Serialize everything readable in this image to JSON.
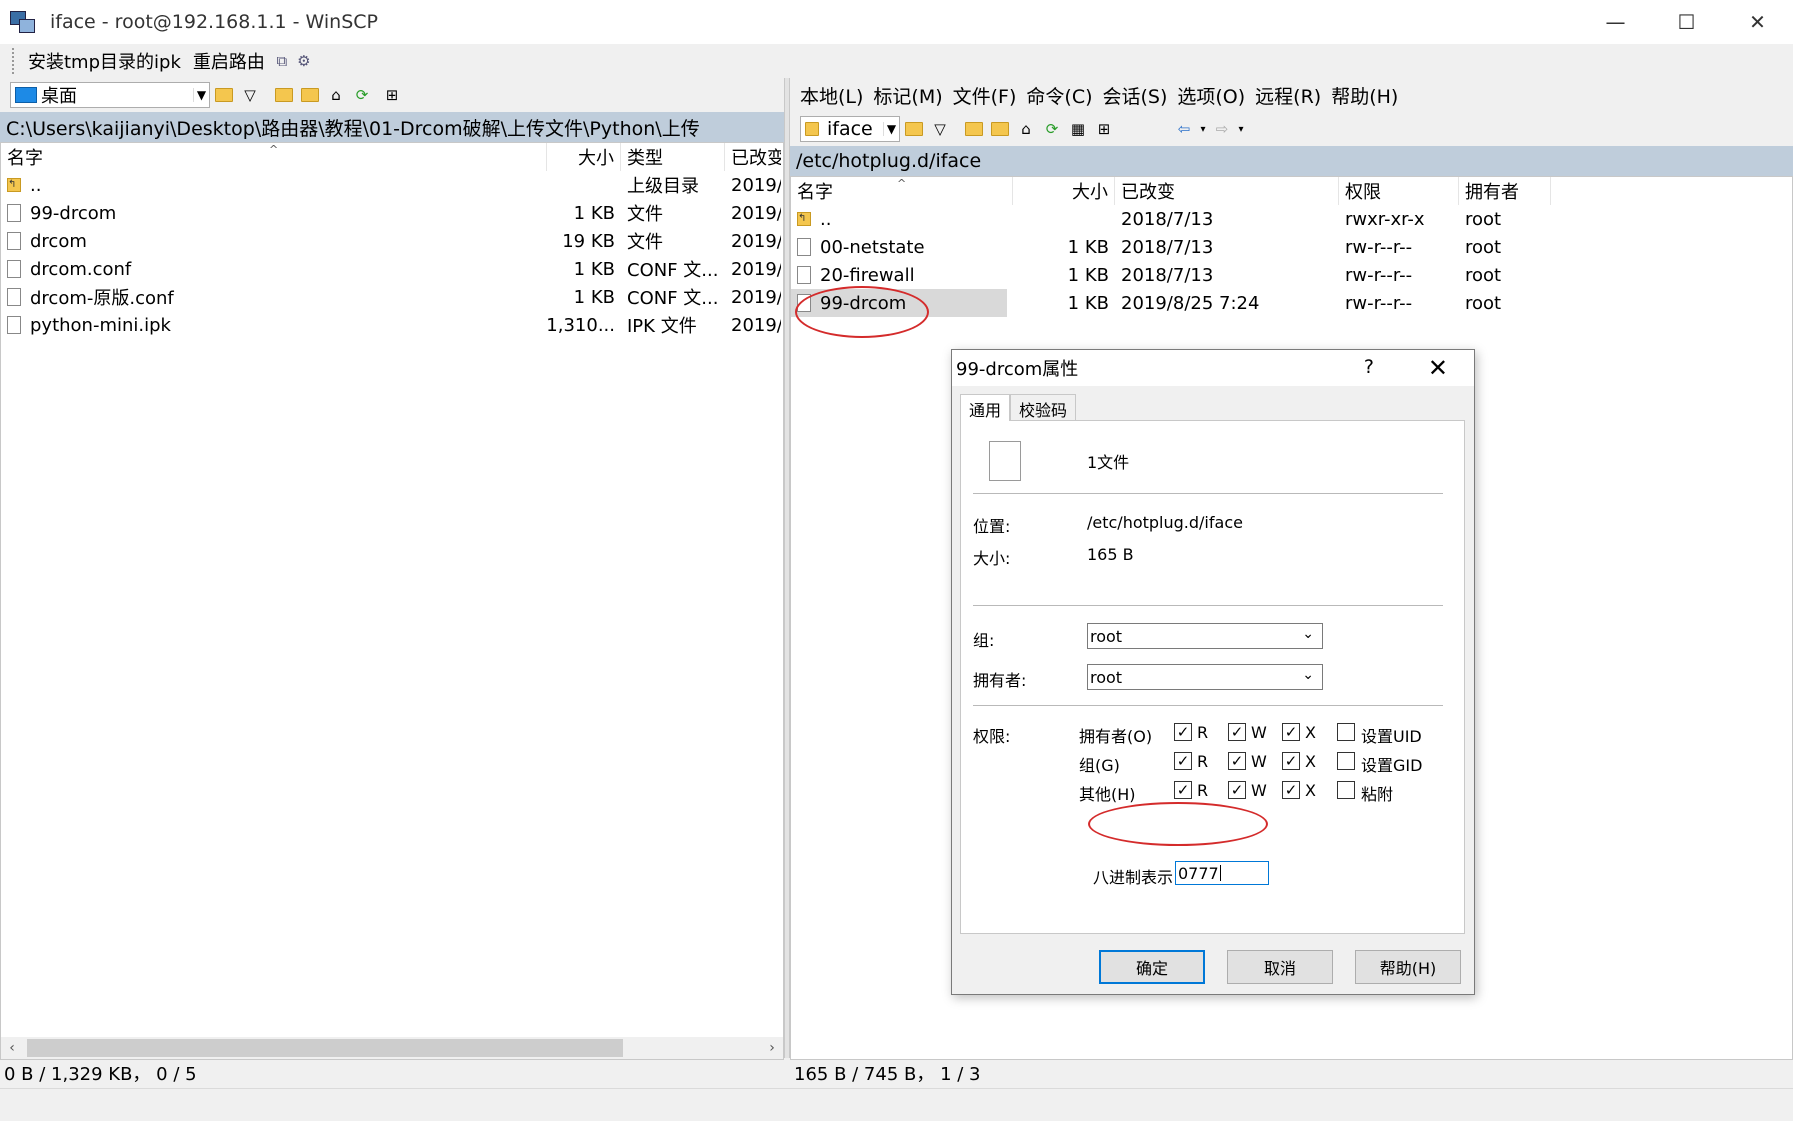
{
  "window": {
    "title": "iface - root@192.168.1.1 - WinSCP",
    "minimize": "—",
    "maximize": "☐",
    "close": "✕"
  },
  "custom_commands": {
    "install": "安装tmp目录的ipk",
    "restart": "重启路由"
  },
  "local": {
    "drive": "桌面",
    "path": "C:\\Users\\kaijianyi\\Desktop\\路由器\\教程\\01-Drcom破解\\上传文件\\Python\\上传",
    "columns": [
      "名字",
      "大小",
      "类型",
      "已改变"
    ],
    "files": [
      {
        "name": "..",
        "size": "",
        "type": "上级目录",
        "changed": "2019/"
      },
      {
        "name": "99-drcom",
        "size": "1 KB",
        "type": "文件",
        "changed": "2019/"
      },
      {
        "name": "drcom",
        "size": "19 KB",
        "type": "文件",
        "changed": "2019/"
      },
      {
        "name": "drcom.conf",
        "size": "1 KB",
        "type": "CONF 文...",
        "changed": "2019/"
      },
      {
        "name": "drcom-原版.conf",
        "size": "1 KB",
        "type": "CONF 文...",
        "changed": "2019/"
      },
      {
        "name": "python-mini.ipk",
        "size": "1,310...",
        "type": "IPK 文件",
        "changed": "2019/"
      }
    ],
    "status": "0 B / 1,329 KB， 0 / 5"
  },
  "remote": {
    "menu": [
      "本地(L)",
      "标记(M)",
      "文件(F)",
      "命令(C)",
      "会话(S)",
      "选项(O)",
      "远程(R)",
      "帮助(H)"
    ],
    "folder": "iface",
    "path": "/etc/hotplug.d/iface",
    "columns": [
      "名字",
      "大小",
      "已改变",
      "权限",
      "拥有者"
    ],
    "files": [
      {
        "name": "..",
        "size": "",
        "changed": "2018/7/13",
        "rights": "rwxr-xr-x",
        "owner": "root"
      },
      {
        "name": "00-netstate",
        "size": "1 KB",
        "changed": "2018/7/13",
        "rights": "rw-r--r--",
        "owner": "root"
      },
      {
        "name": "20-firewall",
        "size": "1 KB",
        "changed": "2018/7/13",
        "rights": "rw-r--r--",
        "owner": "root"
      },
      {
        "name": "99-drcom",
        "size": "1 KB",
        "changed": "2019/8/25 7:24",
        "rights": "rw-r--r--",
        "owner": "root"
      }
    ],
    "status": "165 B / 745 B， 1 / 3"
  },
  "dialog": {
    "title": "99-drcom属性",
    "help": "?",
    "close": "✕",
    "tabs": [
      "通用",
      "校验码"
    ],
    "file_count": "1文件",
    "location_label": "位置:",
    "location": "/etc/hotplug.d/iface",
    "size_label": "大小:",
    "size": "165 B",
    "group_label": "组:",
    "group": "root",
    "owner_label": "拥有者:",
    "owner": "root",
    "perm_label": "权限:",
    "perm_rows": [
      {
        "label": "拥有者(O)",
        "r": "R",
        "w": "W",
        "x": "X",
        "extra": "设置UID"
      },
      {
        "label": "组(G)",
        "r": "R",
        "w": "W",
        "x": "X",
        "extra": "设置GID"
      },
      {
        "label": "其他(H)",
        "r": "R",
        "w": "W",
        "x": "X",
        "extra": "粘附"
      }
    ],
    "octal_label": "八进制表示",
    "octal": "0777",
    "ok": "确定",
    "cancel": "取消",
    "helpbtn": "帮助(H)"
  }
}
